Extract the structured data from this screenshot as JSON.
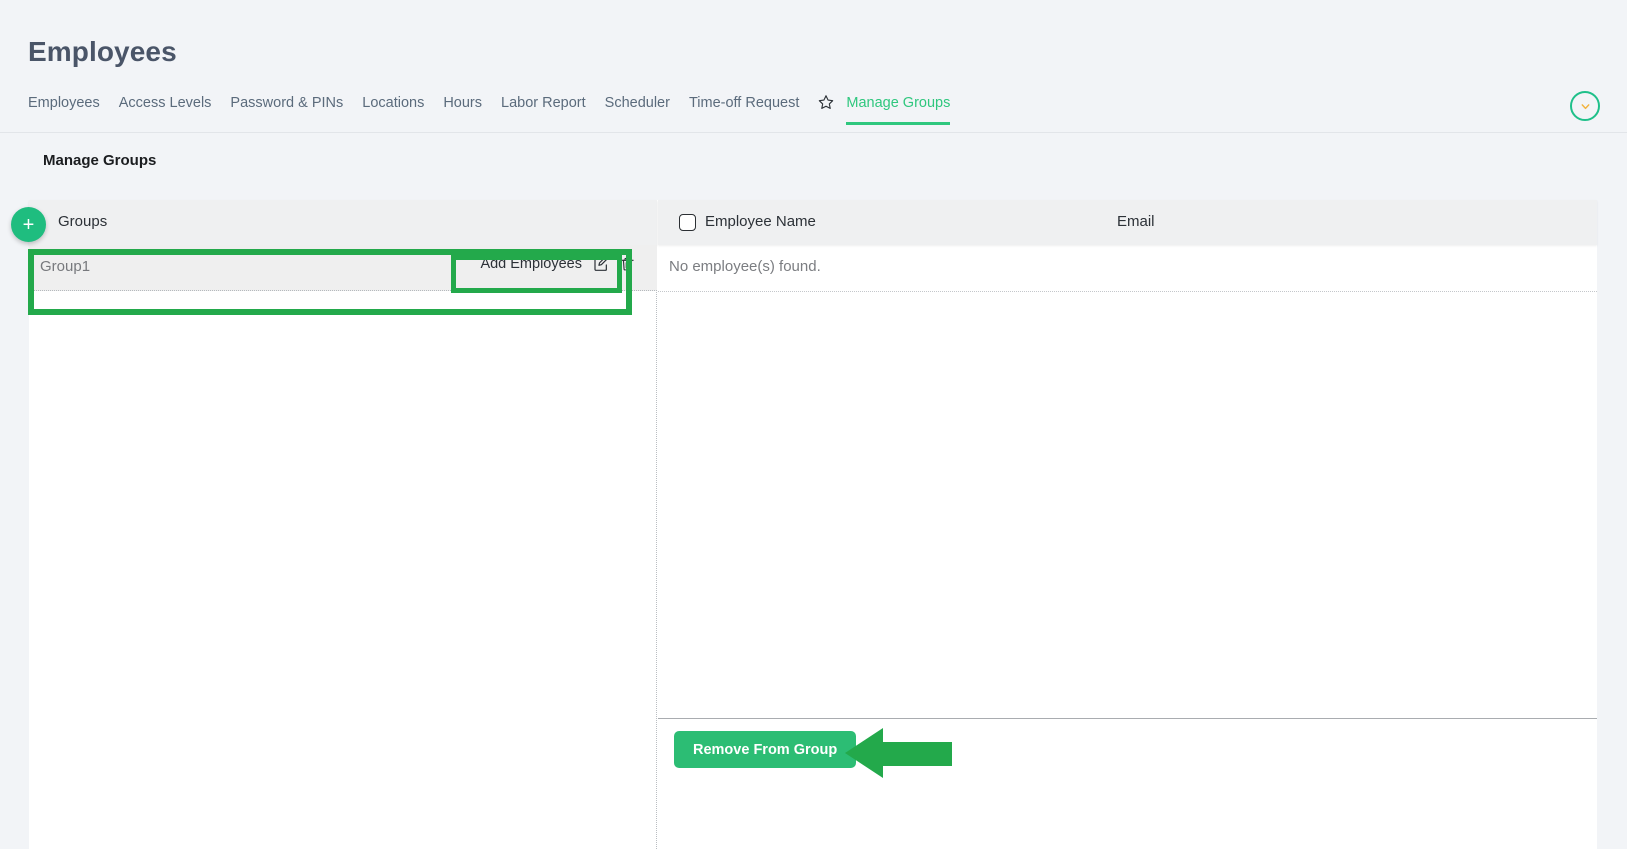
{
  "page": {
    "title": "Employees",
    "section_title": "Manage Groups"
  },
  "tabs": [
    {
      "label": "Employees",
      "active": false
    },
    {
      "label": "Access Levels",
      "active": false
    },
    {
      "label": "Password & PINs",
      "active": false
    },
    {
      "label": "Locations",
      "active": false
    },
    {
      "label": "Hours",
      "active": false
    },
    {
      "label": "Labor Report",
      "active": false
    },
    {
      "label": "Scheduler",
      "active": false
    },
    {
      "label": "Time-off Request",
      "active": false
    },
    {
      "label": "Manage Groups",
      "active": true
    }
  ],
  "tabbar": {
    "favorite_icon": "star-outline-icon",
    "expand_icon": "chevron-down-icon"
  },
  "groups_panel": {
    "header_label": "Groups",
    "add_button_label": "+",
    "rows": [
      {
        "name": "Group1",
        "action_label": "Add Employees",
        "edit_icon": "edit-pencil-icon",
        "delete_icon": "trash-icon"
      }
    ]
  },
  "employees_table": {
    "columns": [
      "Employee Name",
      "Email"
    ],
    "select_all_checkbox": false,
    "empty_message": "No employee(s) found.",
    "rows": [],
    "remove_button_label": "Remove From Group"
  },
  "annotations": {
    "row_highlight": "green-rectangle-around-group-row",
    "action_highlight": "green-rectangle-around-add-employees",
    "arrow": "green-left-arrow-pointing-to-remove-from-group"
  },
  "colors": {
    "accent_green": "#2fc77e",
    "button_green": "#2cbd74",
    "annotation_green": "#23a94b",
    "page_background": "#f2f4f7",
    "header_row": "#eff0f1",
    "title_text": "#4a5568"
  }
}
